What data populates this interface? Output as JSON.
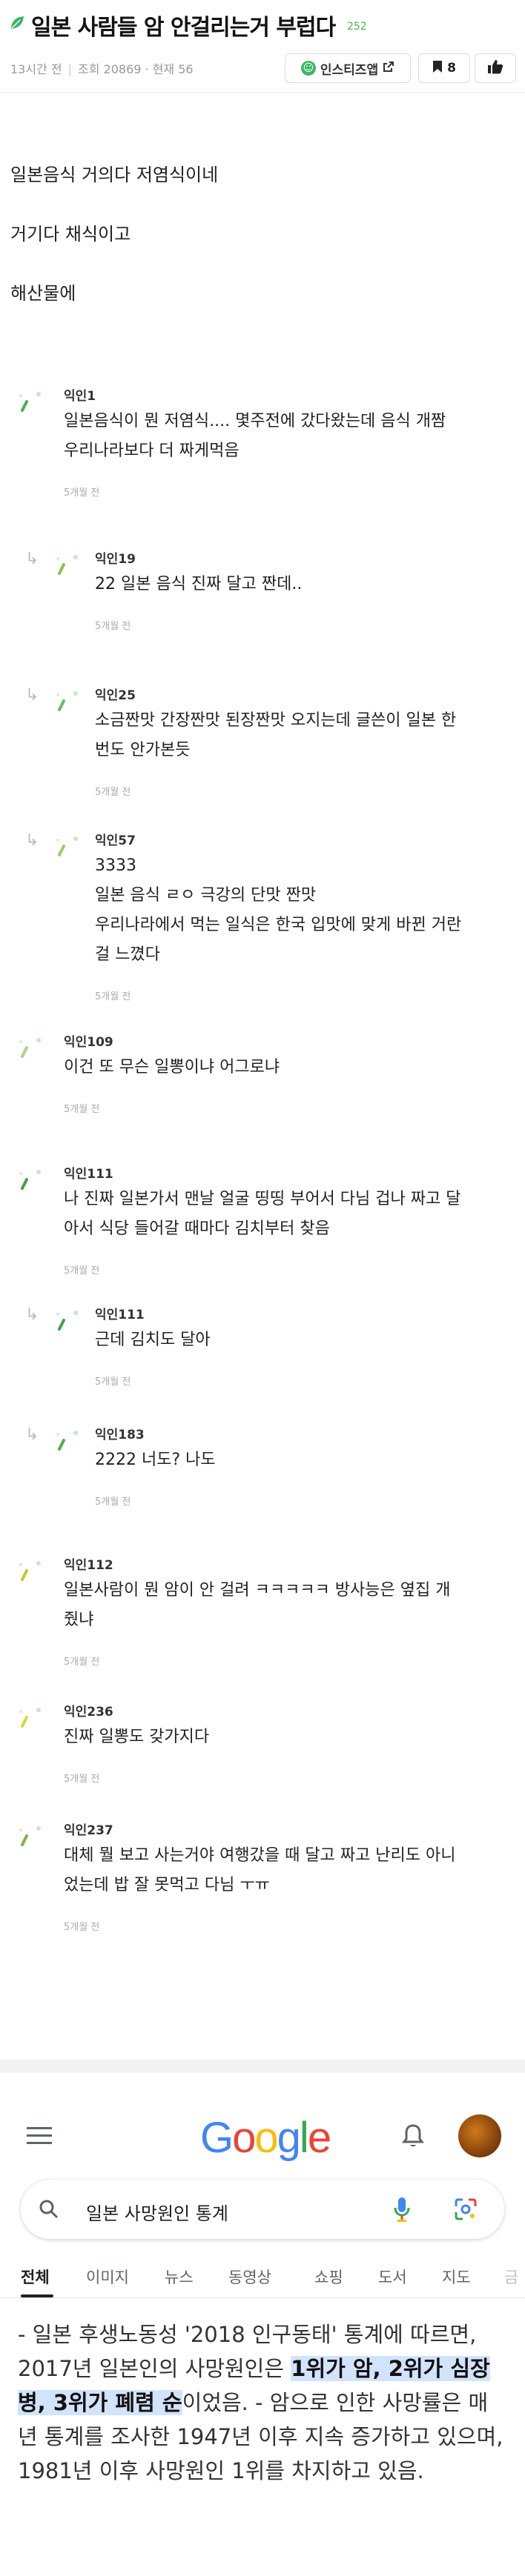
{
  "post": {
    "title": "일본 사람들 암 안걸리는거 부럽다",
    "badge": "252",
    "time": "13시간 전",
    "views": "조회 20869",
    "current": "현재 56",
    "app_button": "인스티즈앱",
    "scrap_count": "8",
    "body": [
      "일본음식 거의다 저염식이네",
      "거기다 채식이고",
      "해산물에"
    ]
  },
  "comments": [
    {
      "name": "익인1",
      "lines": [
        "일본음식이 뭔 저염식.... 몇주전에 갔다왔는데 음식 개짬",
        "우리나라보다 더 짜게먹음"
      ],
      "time": "5개월 전",
      "reply": false,
      "avatar_color": "#4caf50"
    },
    {
      "name": "익인19",
      "lines": [
        "22 일본 음식 진짜 달고 짠데.."
      ],
      "time": "5개월 전",
      "reply": true,
      "avatar_color": "#8bc34a"
    },
    {
      "name": "익인25",
      "lines": [
        "소금짠맛 간장짠맛 된장짠맛 오지는데 글쓴이 일본 한",
        "번도 안가본듯"
      ],
      "time": "5개월 전",
      "reply": true,
      "avatar_color": "#66bb6a"
    },
    {
      "name": "익인57",
      "lines": [
        "3333",
        "일본 음식 ㄹㅇ 극강의 단맛 짠맛",
        "우리나라에서 먹는 일식은 한국 입맛에 맞게 바뀐 거란",
        "걸 느꼈다"
      ],
      "time": "5개월 전",
      "reply": true,
      "avatar_color": "#9ccc65"
    },
    {
      "name": "익인109",
      "lines": [
        "이건 또 무슨 일뽕이냐 어그로냐"
      ],
      "time": "5개월 전",
      "reply": false,
      "avatar_color": "#aed581"
    },
    {
      "name": "익인111",
      "lines": [
        "나 진짜 일본가서 맨날 얼굴 띵띵 부어서 다님 겁나 짜고 달",
        "아서 식당 들어갈 때마다 김치부터 찾음"
      ],
      "time": "5개월 전",
      "reply": false,
      "avatar_color": "#43a047"
    },
    {
      "name": "익인111",
      "lines": [
        "근데 김치도 달아"
      ],
      "time": "5개월 전",
      "reply": true,
      "avatar_color": "#43a047"
    },
    {
      "name": "익인183",
      "lines": [
        "2222 너도? 나도"
      ],
      "time": "5개월 전",
      "reply": true,
      "avatar_color": "#4caf50"
    },
    {
      "name": "익인112",
      "lines": [
        "일본사람이 뭔 암이 안 걸려 ㅋㅋㅋㅋㅋ 방사능은 옆집 개",
        "줬냐"
      ],
      "time": "5개월 전",
      "reply": false,
      "avatar_color": "#c0ca33"
    },
    {
      "name": "익인236",
      "lines": [
        "진짜 일뽕도 갖가지다"
      ],
      "time": "5개월 전",
      "reply": false,
      "avatar_color": "#cddc39"
    },
    {
      "name": "익인237",
      "lines": [
        "대체 뭘 보고 사는거야 여행갔을 때 달고 짜고 난리도 아니",
        "었는데 밥 잘 못먹고 다님 ㅜㅠ"
      ],
      "time": "5개월 전",
      "reply": false,
      "avatar_color": "#7cb342"
    }
  ],
  "google": {
    "logo": "Google",
    "query": "일본 사망원인 통계",
    "tabs": [
      "전체",
      "이미지",
      "뉴스",
      "동영상",
      "쇼핑",
      "도서",
      "지도",
      "금"
    ],
    "result_parts": [
      {
        "t": "- 일본 후생노동성 '2018 인구동태' 통계에 따르면, 2017년 일본인의 사망원인은 ",
        "hl": false
      },
      {
        "t": "1위가 암, 2위가 심장병, 3위가 폐렴 순",
        "hl": true
      },
      {
        "t": "이었음. - 암으로 인한 사망률은 매년 통계를 조사한 1947년 이후 지속 증가하고 있으며, 1981년 이후 사망원인 1위를 차지하고 있음.",
        "hl": false
      }
    ]
  },
  "colors": {
    "brand_green": "#3cb66a",
    "google_highlight": "#d2e3fc"
  }
}
